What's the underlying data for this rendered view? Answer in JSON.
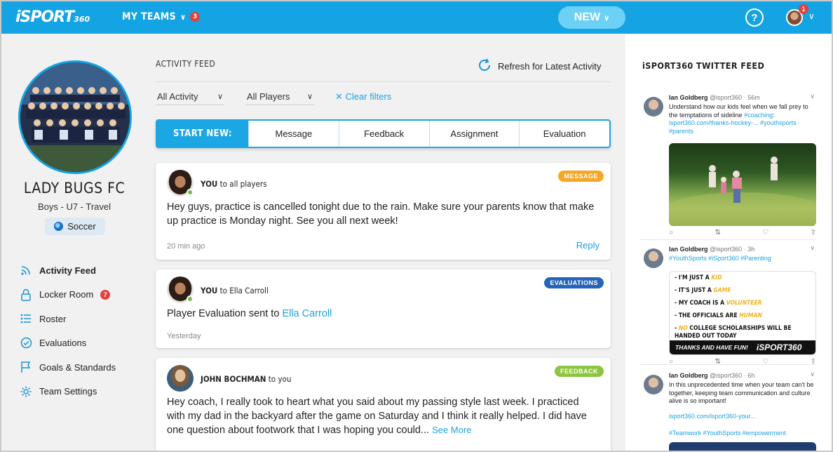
{
  "header": {
    "logo": "iSPORT",
    "logo_suffix": "360",
    "my_teams": "MY TEAMS",
    "my_teams_badge": "3",
    "new_button": "NEW",
    "help": "?",
    "notification_badge": "1"
  },
  "team": {
    "name": "LADY BUGS FC",
    "subtitle": "Boys - U7 - Travel",
    "sport": "Soccer"
  },
  "sidebar": {
    "items": [
      {
        "label": "Activity Feed",
        "icon": "rss-icon"
      },
      {
        "label": "Locker Room",
        "icon": "lock-icon",
        "badge": "7"
      },
      {
        "label": "Roster",
        "icon": "list-icon"
      },
      {
        "label": "Evaluations",
        "icon": "check-circle-icon"
      },
      {
        "label": "Goals & Standards",
        "icon": "flag-icon"
      },
      {
        "label": "Team Settings",
        "icon": "gear-icon"
      }
    ]
  },
  "feed": {
    "title": "ACTIVITY FEED",
    "refresh": "Refresh for Latest Activity",
    "filter_activity": "All Activity",
    "filter_players": "All Players",
    "clear_filters": "Clear filters",
    "start_new_label": "START NEW:",
    "start_options": [
      "Message",
      "Feedback",
      "Assignment",
      "Evaluation"
    ],
    "posts": [
      {
        "author": "YOU",
        "audience": "to all players",
        "tag": "MESSAGE",
        "tag_color": "#f5a623",
        "text": "Hey guys, practice is cancelled tonight due to the rain. Make sure your parents know that make up practice is Monday night. See you all next week!",
        "time": "20 min ago",
        "reply": "Reply"
      },
      {
        "author": "YOU",
        "audience": "to Ella Carroll",
        "tag": "EVALUATIONS",
        "tag_color": "#2564b8",
        "text": "Player Evaluation sent to ",
        "link": "Ella Carroll",
        "time": "Yesterday"
      },
      {
        "author": "JOHN BOCHMAN",
        "audience": "to you",
        "tag": "FEEDBACK",
        "tag_color": "#8cc63f",
        "text": "Hey coach, I really took to heart what you said about my passing style last week. I practiced with my dad in the backyard after the game on Saturday and I think it really helped. I did have one question about footwork that I was hoping you could...",
        "see_more": "See More"
      }
    ]
  },
  "twitter": {
    "title": "iSPORT360 TWITTER FEED",
    "tweets": [
      {
        "name": "Ian Goldberg",
        "handle": "@isport360 · 56m",
        "text": "Understand how our kids feel when we fall prey to the temptations of sideline ",
        "hashtag": "#coaching",
        "text2": ":",
        "link": "isport360.com/thanks-hockey-... #youthsports",
        "link2": "#parents"
      },
      {
        "name": "Ian Goldberg",
        "handle": "@isport360 · 3h",
        "tags": "#YouthSports #iSport360 #Parenting",
        "poster": [
          {
            "pre": "- I'M ",
            "hl": "JUST A",
            "post": " ",
            "hl2": "KID"
          },
          {
            "pre": "- IT'S JUST A ",
            "hl": "",
            "post": "",
            "hl2": "GAME"
          },
          {
            "pre": "- MY COACH IS A ",
            "hl": "",
            "post": "",
            "hl2": "VOLUNTEER"
          },
          {
            "pre": "- THE OFFICIALS ARE ",
            "hl": "",
            "post": "",
            "hl2": "HUMAN"
          },
          {
            "pre": "- ",
            "hl": "NO",
            "post": " COLLEGE SCHOLARSHIPS WILL BE",
            "hl2": ""
          },
          {
            "pre": "  HANDED OUT TODAY",
            "hl": "",
            "post": "",
            "hl2": ""
          }
        ],
        "poster_band": "THANKS AND HAVE FUN!",
        "poster_logo": "iSPORT360"
      },
      {
        "name": "Ian Goldberg",
        "handle": "@isport360 · 6h",
        "text": "In this unprecedented time when your team can't be together, keeping team communication and culture alive is so important!",
        "link": "isport360.com/isport360-your...",
        "tags": "#Teamwork #YouthSports #empowerment"
      }
    ]
  },
  "colors": {
    "brand": "#14a3e3",
    "message": "#f5a623",
    "evaluations": "#2564b8",
    "feedback": "#8cc63f"
  }
}
